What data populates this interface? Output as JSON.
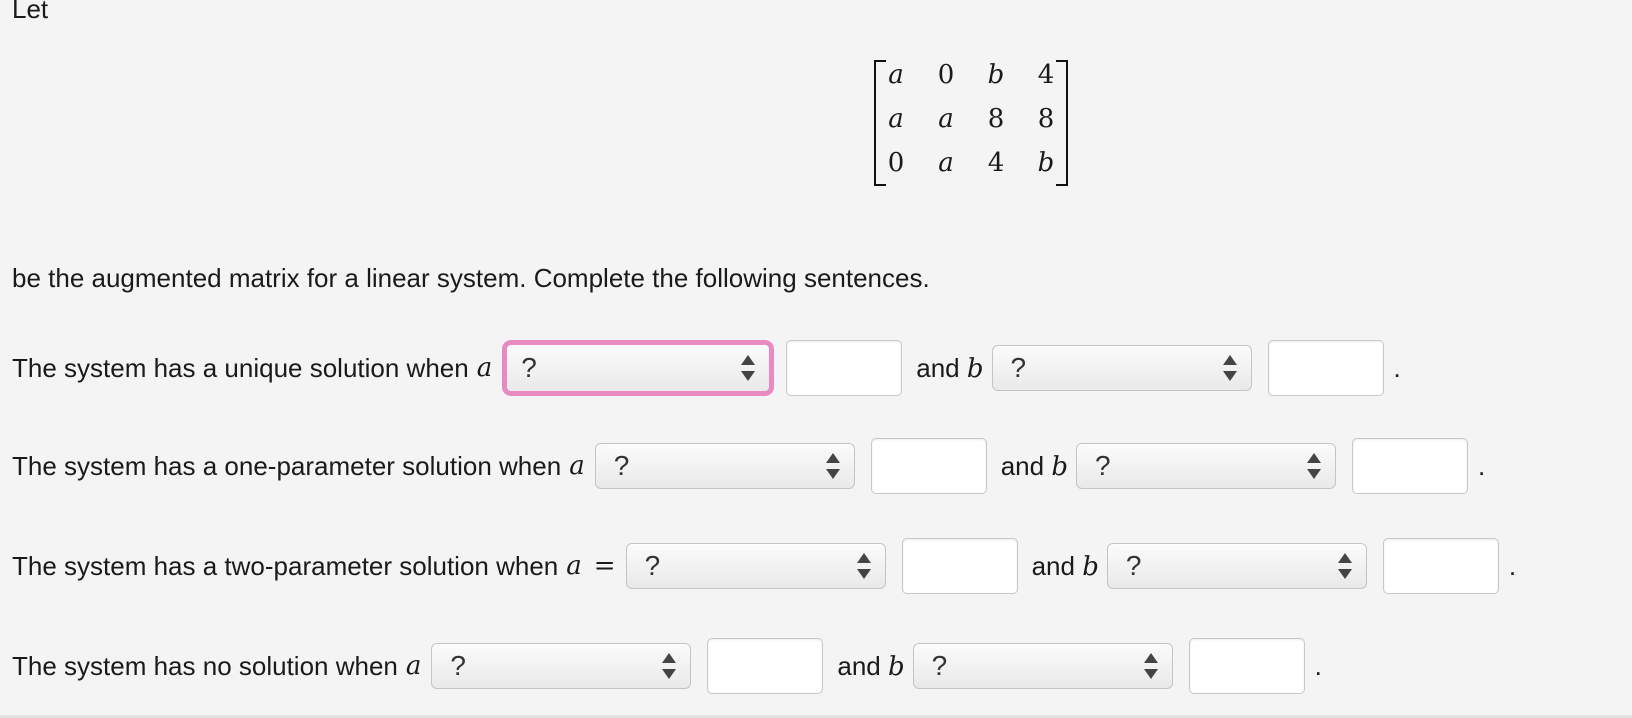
{
  "intro": "Let",
  "matrix": {
    "rows": [
      [
        "a",
        "0",
        "b",
        "4"
      ],
      [
        "a",
        "a",
        "8",
        "8"
      ],
      [
        "0",
        "a",
        "4",
        "b"
      ]
    ]
  },
  "description": "be the augmented matrix for a linear system. Complete the following sentences.",
  "sentences": [
    {
      "text": "The system has a unique solution when",
      "var_a": "a",
      "eq": "",
      "select_a": "?",
      "and_text": "and",
      "var_b": "b",
      "select_b": "?",
      "end": "."
    },
    {
      "text": "The system has a one-parameter solution when",
      "var_a": "a",
      "eq": "",
      "select_a": "?",
      "and_text": "and",
      "var_b": "b",
      "select_b": "?",
      "end": "."
    },
    {
      "text": "The system has a two-parameter solution when",
      "var_a": "a",
      "eq": "=",
      "select_a": "?",
      "and_text": "and",
      "var_b": "b",
      "select_b": "?",
      "end": "."
    },
    {
      "text": "The system has no solution when",
      "var_a": "a",
      "eq": "",
      "select_a": "?",
      "and_text": "and",
      "var_b": "b",
      "select_b": "?",
      "end": "."
    }
  ],
  "colors": {
    "focus_ring": "#e98ac2",
    "background": "#f4f4f4"
  }
}
